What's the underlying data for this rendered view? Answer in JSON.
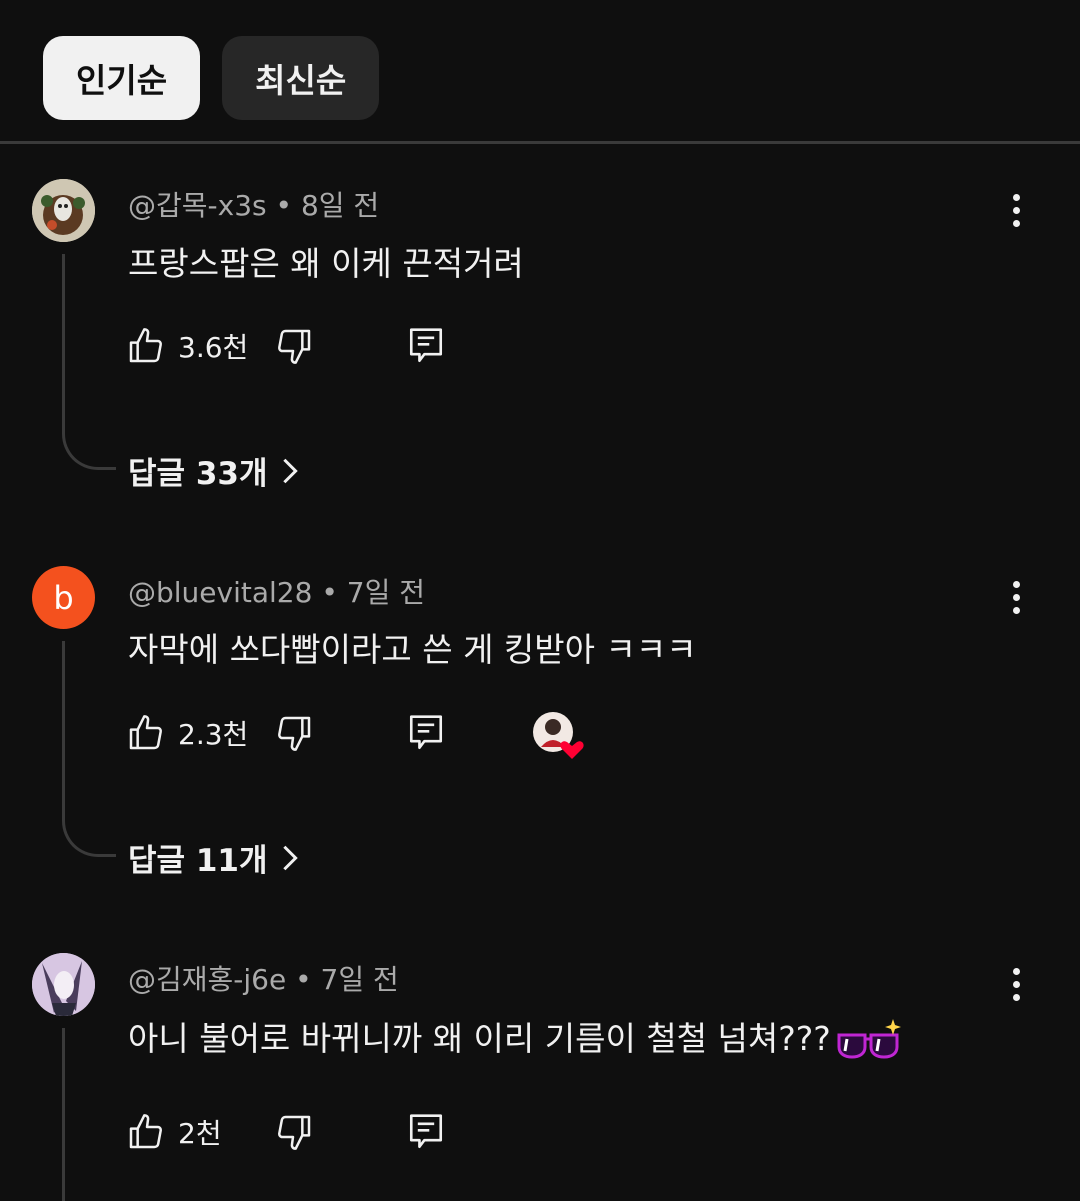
{
  "sort": {
    "popular_label": "인기순",
    "newest_label": "최신순"
  },
  "comments": [
    {
      "handle": "@갑목-x3s",
      "separator": "•",
      "time": "8일 전",
      "text": "프랑스팝은 왜 이케 끈적거려",
      "likes": "3.6천",
      "replies_label": "답글 33개"
    },
    {
      "handle": "@bluevital28",
      "separator": "•",
      "time": "7일 전",
      "avatar_letter": "b",
      "avatar_color": "#f4511e",
      "text": "자막에 쏘다빱이라고 쓴 게 킹받아 ㅋㅋㅋ",
      "likes": "2.3천",
      "replies_label": "답글 11개",
      "creator_hearted": true
    },
    {
      "handle": "@김재홍-j6e",
      "separator": "•",
      "time": "7일 전",
      "text": "아니 불어로 바뀌니까 왜 이리 기름이 철철 넘쳐???",
      "likes": "2천"
    }
  ],
  "icons": {
    "like": "thumbs-up-icon",
    "dislike": "thumbs-down-icon",
    "reply": "reply-icon",
    "more": "more-vertical-icon",
    "chevron": "chevron-right-icon"
  },
  "colors": {
    "background": "#0f0f0f",
    "chip_active": "#f1f1f1",
    "chip_inactive": "#272727",
    "meta_text": "#aaaaaa",
    "heart": "#ff0033"
  }
}
